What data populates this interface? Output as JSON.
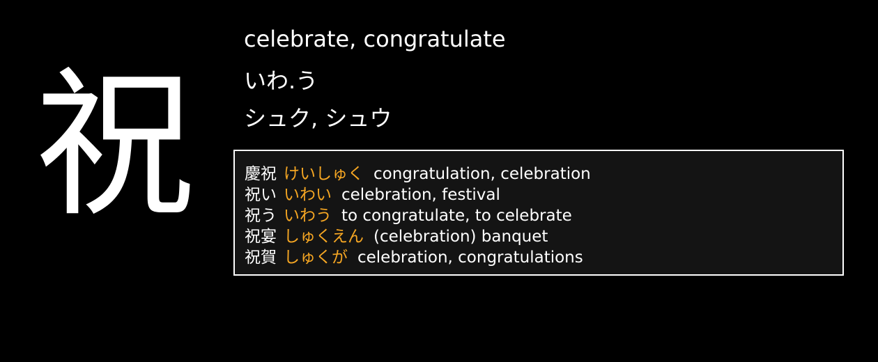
{
  "kanji": {
    "character": "祝",
    "meaning": "celebrate, congratulate",
    "kun_reading": "いわ.う",
    "on_reading": "シュク, シュウ"
  },
  "colors": {
    "background": "#000000",
    "text": "#ffffff",
    "reading_accent": "#f5a623",
    "box_background": "#141414",
    "box_border": "#ffffff"
  },
  "vocabulary": [
    {
      "word": "慶祝",
      "reading": "けいしゅく",
      "gloss": "congratulation, celebration"
    },
    {
      "word": "祝い",
      "reading": "いわい",
      "gloss": "celebration, festival"
    },
    {
      "word": "祝う",
      "reading": "いわう",
      "gloss": "to congratulate, to celebrate"
    },
    {
      "word": "祝宴",
      "reading": "しゅくえん",
      "gloss": "(celebration) banquet"
    },
    {
      "word": "祝賀",
      "reading": "しゅくが",
      "gloss": "celebration, congratulations"
    }
  ]
}
